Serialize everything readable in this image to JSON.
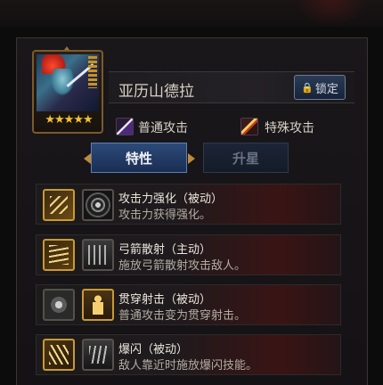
{
  "hero": {
    "name": "亚历山德拉",
    "stars": "★★★★★",
    "star_rating": 5
  },
  "lock_button": {
    "icon": "lock-icon",
    "label": "锁定"
  },
  "attacks": {
    "normal": {
      "icon": "normal-attack-icon",
      "label": "普通攻击"
    },
    "special": {
      "icon": "special-attack-icon",
      "label": "特殊攻击"
    }
  },
  "tabs": [
    {
      "label": "特性",
      "active": true
    },
    {
      "label": "升星",
      "active": false
    }
  ],
  "skills": [
    {
      "title": "攻击力强化（被动）",
      "desc": "攻击力获得强化。",
      "icons": [
        "arrow-volley-icon",
        "target-icon"
      ],
      "active_icon": 0
    },
    {
      "title": "弓箭散射（主动）",
      "desc": "施放弓箭散射攻击敌人。",
      "icons": [
        "arrow-fan-icon",
        "arrow-rain-icon"
      ],
      "active_icon": 0
    },
    {
      "title": "贯穿射击（被动）",
      "desc": "普通攻击变为贯穿射击。",
      "icons": [
        "burst-icon",
        "archer-figure-icon"
      ],
      "active_icon": 1
    },
    {
      "title": "爆闪（被动）",
      "desc": "敌人靠近时施放爆闪技能。",
      "icons": [
        "flash-icon",
        "claw-icon"
      ],
      "active_icon": 0
    }
  ],
  "colors": {
    "accent_gold": "#c99a32",
    "tab_active": "#2c4a7a",
    "star": "#f2c232"
  }
}
